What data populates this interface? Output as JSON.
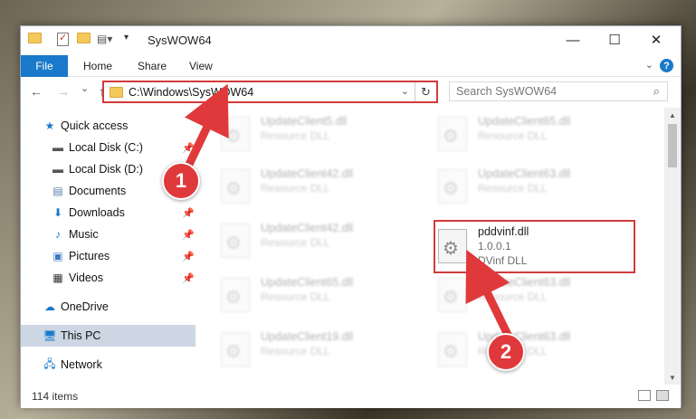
{
  "window": {
    "title": "SysWOW64"
  },
  "window_controls": {
    "minimize": "—",
    "maximize": "☐",
    "close": "✕"
  },
  "ribbon": {
    "tabs": [
      "File",
      "Home",
      "Share",
      "View"
    ],
    "help": "?"
  },
  "nav": {
    "back": "←",
    "forward": "→",
    "recent": "⌄",
    "up": "↑",
    "address": "C:\\Windows\\SysWOW64",
    "search_placeholder": "Search SysWOW64"
  },
  "sidebar": {
    "items": [
      {
        "label": "Quick access",
        "icon": "star-icon"
      },
      {
        "label": "Local Disk (C:)",
        "icon": "drive-icon",
        "pinned": true
      },
      {
        "label": "Local Disk (D:)",
        "icon": "drive-icon"
      },
      {
        "label": "Documents",
        "icon": "documents-icon"
      },
      {
        "label": "Downloads",
        "icon": "download-icon",
        "pinned": true
      },
      {
        "label": "Music",
        "icon": "music-icon",
        "pinned": true
      },
      {
        "label": "Pictures",
        "icon": "pictures-icon",
        "pinned": true
      },
      {
        "label": "Videos",
        "icon": "videos-icon",
        "pinned": true
      },
      {
        "label": "OneDrive",
        "icon": "cloud-icon"
      },
      {
        "label": "This PC",
        "icon": "computer-icon",
        "selected": true
      },
      {
        "label": "Network",
        "icon": "network-icon"
      }
    ]
  },
  "files": [
    {
      "name": "UpdateClient5.dll",
      "line1": "Resource DLL",
      "line2": ""
    },
    {
      "name": "UpdateClient65.dll",
      "line1": "Resource DLL",
      "line2": ""
    },
    {
      "name": "UpdateClient42.dll",
      "line1": "Resource DLL",
      "line2": ""
    },
    {
      "name": "UpdateClient63.dll",
      "line1": "Resource DLL",
      "line2": ""
    },
    {
      "name": "UpdateClient42.dll",
      "line1": "Resource DLL",
      "line2": ""
    },
    {
      "name": "pddvinf.dll",
      "line1": "1.0.0.1",
      "line2": "DVinf DLL"
    },
    {
      "name": "UpdateClient65.dll",
      "line1": "Resource DLL",
      "line2": ""
    },
    {
      "name": "UpdateClient63.dll",
      "line1": "Resource DLL",
      "line2": ""
    },
    {
      "name": "UpdateClient19.dll",
      "line1": "Resource DLL",
      "line2": ""
    },
    {
      "name": "UpdateClient63.dll",
      "line1": "Resource DLL",
      "line2": ""
    }
  ],
  "status": {
    "items_count": "114 items"
  },
  "annotations": {
    "badge1": "1",
    "badge2": "2",
    "color": "#e0393b"
  },
  "colors": {
    "accent": "#1979ca",
    "highlight": "#d23b3b",
    "selected_bg": "#ccd7e3"
  }
}
